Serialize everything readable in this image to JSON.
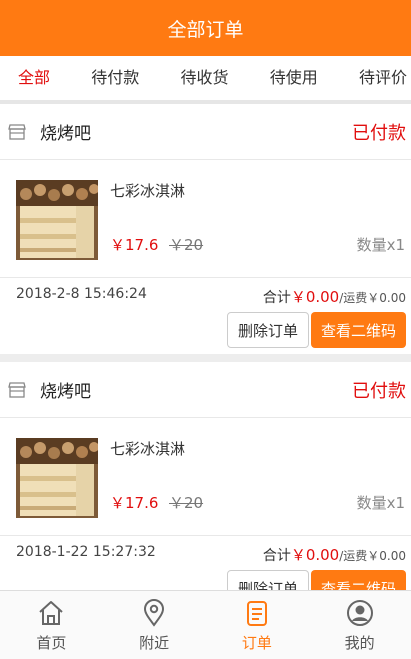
{
  "header": {
    "title": "全部订单"
  },
  "tabs": [
    {
      "label": "全部",
      "active": true
    },
    {
      "label": "待付款",
      "active": false
    },
    {
      "label": "待收货",
      "active": false
    },
    {
      "label": "待使用",
      "active": false
    },
    {
      "label": "待评价",
      "active": false
    }
  ],
  "orders": [
    {
      "shop_name": "烧烤吧",
      "status": "已付款",
      "product_name": "七彩冰淇淋",
      "price": "￥17.6",
      "old_price": "￥20",
      "quantity": "数量x1",
      "time": "2018-2-8 15:46:24",
      "total_label": "合计",
      "total": "￥0.00",
      "shipping": "/运费￥0.00",
      "delete_label": "删除订单",
      "qr_label": "查看二维码"
    },
    {
      "shop_name": "烧烤吧",
      "status": "已付款",
      "product_name": "七彩冰淇淋",
      "price": "￥17.6",
      "old_price": "￥20",
      "quantity": "数量x1",
      "time": "2018-1-22 15:27:32",
      "total_label": "合计",
      "total": "￥0.00",
      "shipping": "/运费￥0.00",
      "delete_label": "删除订单",
      "qr_label": "查看二维码"
    }
  ],
  "nav": [
    {
      "label": "首页",
      "icon": "home-icon",
      "active": false
    },
    {
      "label": "附近",
      "icon": "location-pin-icon",
      "active": false
    },
    {
      "label": "订单",
      "icon": "order-list-icon",
      "active": true
    },
    {
      "label": "我的",
      "icon": "user-avatar-icon",
      "active": false
    }
  ],
  "colors": {
    "accent": "#ff7a12",
    "status_red": "#e10e0e"
  }
}
